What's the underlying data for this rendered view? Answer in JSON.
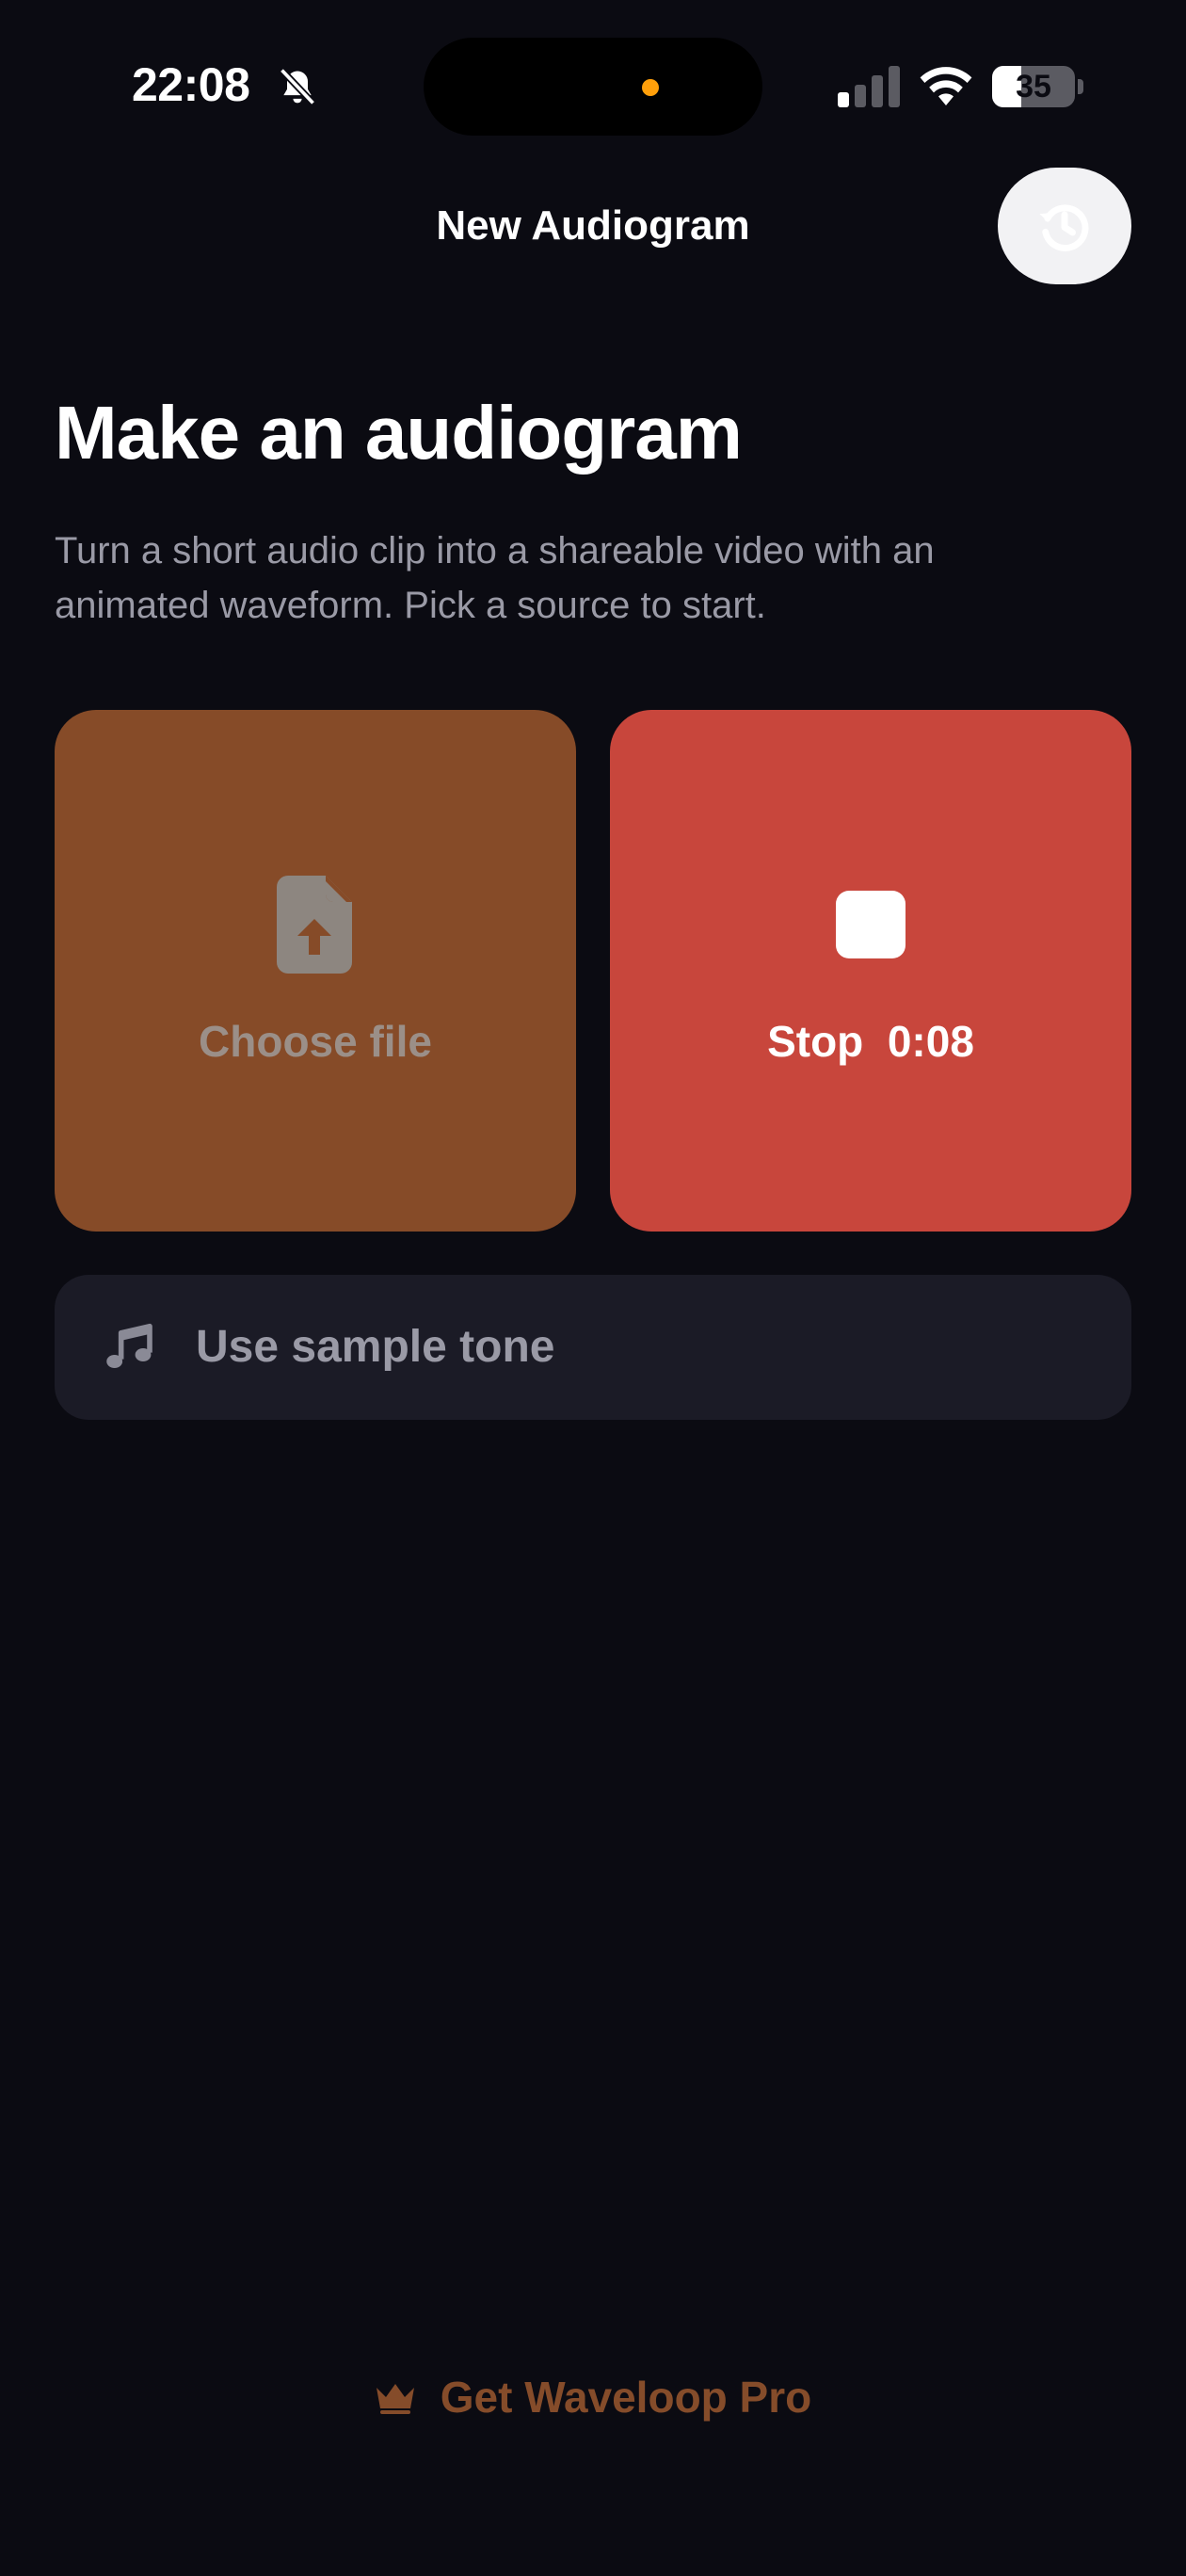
{
  "status_bar": {
    "time": "22:08",
    "battery_level": "35",
    "battery_fraction": 0.35,
    "icons": [
      "bell-slash-icon",
      "signal-icon",
      "wifi-icon",
      "battery-icon"
    ]
  },
  "nav": {
    "title": "New Audiogram",
    "history_button_icon": "history-icon"
  },
  "main": {
    "title": "Make an audiogram",
    "description": "Turn a short audio clip into a shareable video with an animated waveform. Pick a source to start.",
    "tiles": [
      {
        "label": "Choose file",
        "icon": "file-upload-icon",
        "color": "#864b28"
      },
      {
        "label": "Stop  0:08",
        "icon": "stop-icon",
        "color": "#c8463c"
      }
    ],
    "sample_tone": {
      "label": "Use sample tone",
      "icon": "music-note-icon"
    }
  },
  "footer": {
    "pro_label": "Get Waveloop Pro",
    "pro_icon": "crown-icon",
    "accent_color": "#854c2a"
  }
}
